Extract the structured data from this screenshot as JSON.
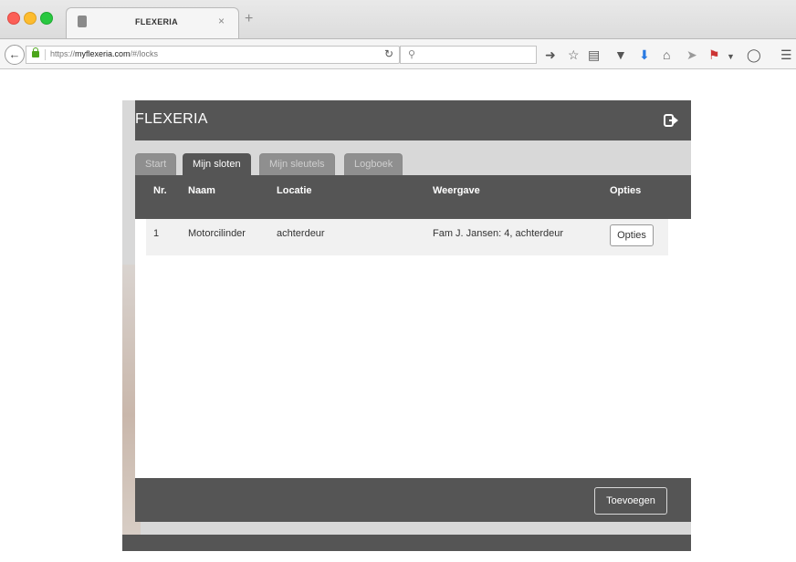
{
  "browser": {
    "tab_title": "FLEXERIA",
    "tab_close": "×",
    "new_tab": "+",
    "url_prefix": "https://",
    "url_host": "myflexeria.com",
    "url_path": "/#/locks",
    "icons": [
      "back-icon",
      "lock-icon",
      "reload-icon",
      "search-icon",
      "go-icon",
      "bookmark-star-icon",
      "reading-list-icon",
      "pocket-icon",
      "download-icon",
      "home-icon",
      "send-icon",
      "extension-icon",
      "dropdown-icon",
      "chat-icon",
      "menu-icon"
    ]
  },
  "app": {
    "brand": "FLEXERIA",
    "tabs": [
      {
        "label": "Start",
        "active": false
      },
      {
        "label": "Mijn sloten",
        "active": true
      },
      {
        "label": "Mijn sleutels",
        "active": false
      },
      {
        "label": "Logboek",
        "active": false
      }
    ],
    "table": {
      "headers": [
        "Nr.",
        "Naam",
        "Locatie",
        "Weergave",
        "Opties"
      ],
      "rows": [
        {
          "nr": "1",
          "naam": "Motorcilinder",
          "locatie": "achterdeur",
          "weergave": "Fam J. Jansen: 4, achterdeur",
          "opties_label": "Opties"
        }
      ]
    },
    "add_button": "Toevoegen",
    "colors": {
      "header": "#555555",
      "tab_inactive": "#8f8f8f",
      "panel": "#d8d8d8"
    }
  }
}
